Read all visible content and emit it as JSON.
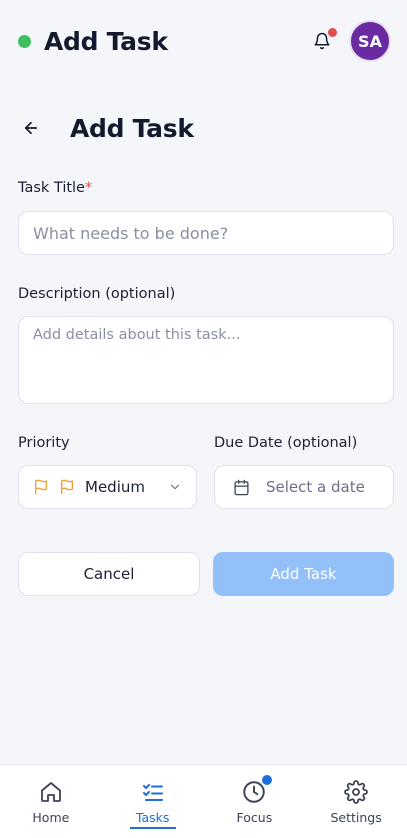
{
  "header": {
    "app_title": "Add Task",
    "avatar_initials": "SA",
    "status_color": "#3fbf5f",
    "notification_dot_color": "#e14b4b"
  },
  "page": {
    "title": "Add Task"
  },
  "form": {
    "title_label": "Task Title",
    "title_required_mark": "*",
    "title_placeholder": "What needs to be done?",
    "description_label": "Description (optional)",
    "description_placeholder": "Add details about this task...",
    "priority_label": "Priority",
    "priority_value": "Medium",
    "due_label": "Due Date (optional)",
    "due_placeholder": "Select a date",
    "cancel_label": "Cancel",
    "submit_label": "Add Task"
  },
  "tabbar": {
    "items": [
      {
        "label": "Home",
        "icon": "home-icon"
      },
      {
        "label": "Tasks",
        "icon": "tasks-icon"
      },
      {
        "label": "Focus",
        "icon": "clock-icon"
      },
      {
        "label": "Settings",
        "icon": "gear-icon"
      }
    ],
    "active": "Tasks",
    "accent": "#1e6fd9"
  }
}
